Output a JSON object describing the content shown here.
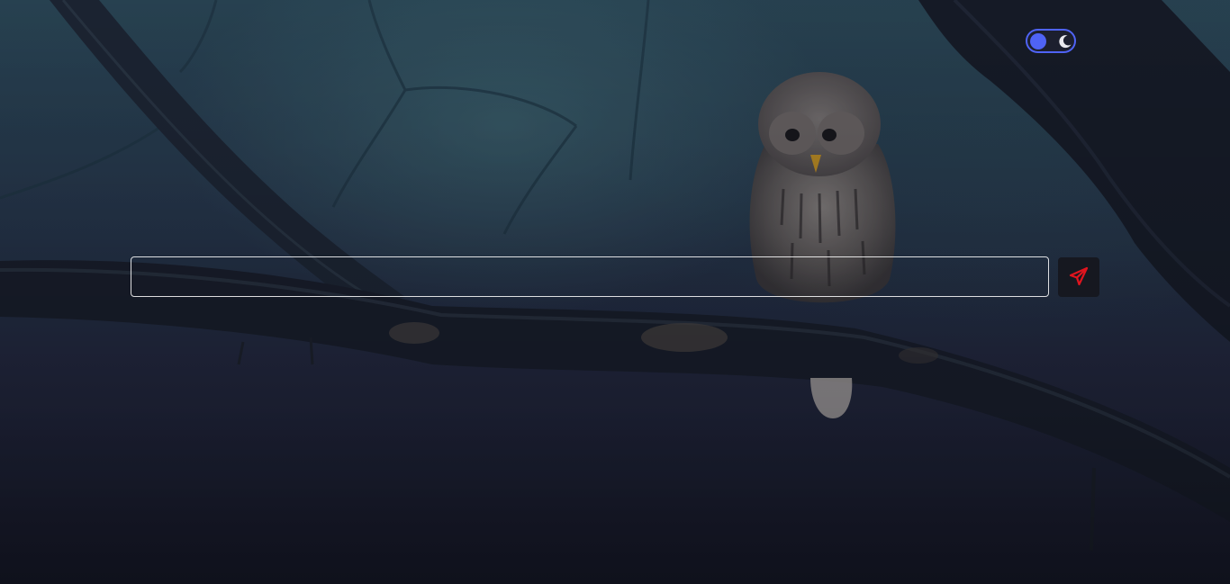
{
  "theme_toggle": {
    "state": "dark",
    "knob_icon": "circle-knob-icon",
    "mode_icon": "moon-icon",
    "accent_color": "#4f63f5"
  },
  "message_box": {
    "value": "",
    "placeholder": ""
  },
  "send_button": {
    "icon": "paper-plane-icon",
    "icon_color": "#e0141e"
  },
  "background": {
    "subject": "owl-on-branch-forest-night"
  }
}
